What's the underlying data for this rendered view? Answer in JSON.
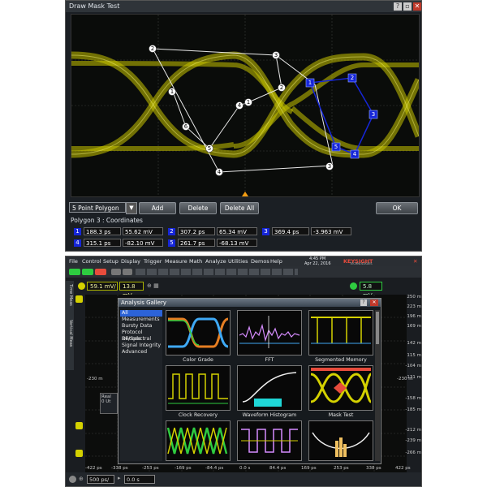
{
  "mask_dialog": {
    "title": "Draw Mask Test",
    "polygon_select": "5 Point Polygon",
    "buttons": {
      "add": "Add",
      "delete": "Delete",
      "delete_all": "Delete All",
      "ok": "OK"
    },
    "coords_title": "Polygon 3 : Coordinates",
    "points": [
      {
        "n": "1",
        "time": "188.3 ps",
        "volt": "55.62 mV"
      },
      {
        "n": "2",
        "time": "307.2 ps",
        "volt": "65.34 mV"
      },
      {
        "n": "3",
        "time": "369.4 ps",
        "volt": "-3.963 mV"
      },
      {
        "n": "4",
        "time": "315.1 ps",
        "volt": "-82.10 mV"
      },
      {
        "n": "5",
        "time": "261.7 ps",
        "volt": "-68.13 mV"
      }
    ],
    "white_vertex_labels": [
      "2",
      "3",
      "1",
      "2",
      "4",
      "1",
      "6",
      "5",
      "4",
      "3"
    ],
    "blue_vertex_labels": [
      "1",
      "2",
      "3",
      "4",
      "5"
    ]
  },
  "scope": {
    "menu": [
      "File",
      "Control",
      "Setup",
      "Display",
      "Trigger",
      "Measure",
      "Math",
      "Analyze",
      "Utilities",
      "Demos",
      "Help"
    ],
    "brand": "KEYSIGHT",
    "brand_sub": "TECHNOLOGIES",
    "date": "Apr 22, 2016",
    "time": "4:45 PM",
    "channel_scale": "59.1 mV/",
    "channel_offset": "13.8 mV",
    "trigger_level": "5.8 mV",
    "side_tab_1": "Time Meas",
    "side_tab_2": "Vertical Meas",
    "y_labels": [
      "250 m",
      "223 m",
      "196 m",
      "169 m",
      "142 m",
      "115 m",
      "-104 m",
      "-131 m",
      "-158 m",
      "-185 m",
      "-212 m",
      "-239 m",
      "-266 m"
    ],
    "x_labels": [
      "-422 ps",
      "-338 ps",
      "-253 ps",
      "-169 ps",
      "-84.4 ps",
      "0.0 s",
      "84.4 ps",
      "169 ps",
      "253 ps",
      "338 ps",
      "422 ps"
    ],
    "cursor_left": "-230 m",
    "cursor_right": "-230 m",
    "realtime_label": "Real",
    "ps_label": "0 Ut",
    "timebase": "500 ps/",
    "delay": "0.0 s",
    "gallery": {
      "title": "Analysis Gallery",
      "categories": [
        "All",
        "Measurements",
        "Bursty Data",
        "Protocol Decode",
        "RF/Spectral",
        "Signal Integrity",
        "Advanced"
      ],
      "selected": "All",
      "thumbs": [
        "Color Grade",
        "FFT",
        "Segmented Memory",
        "Clock Recovery",
        "Waveform Histogram",
        "Mask Test",
        "",
        "",
        ""
      ]
    }
  },
  "colors": {
    "trace": "#d4d100",
    "mask_blue": "#1626d8",
    "accent": "#2c63d8"
  }
}
